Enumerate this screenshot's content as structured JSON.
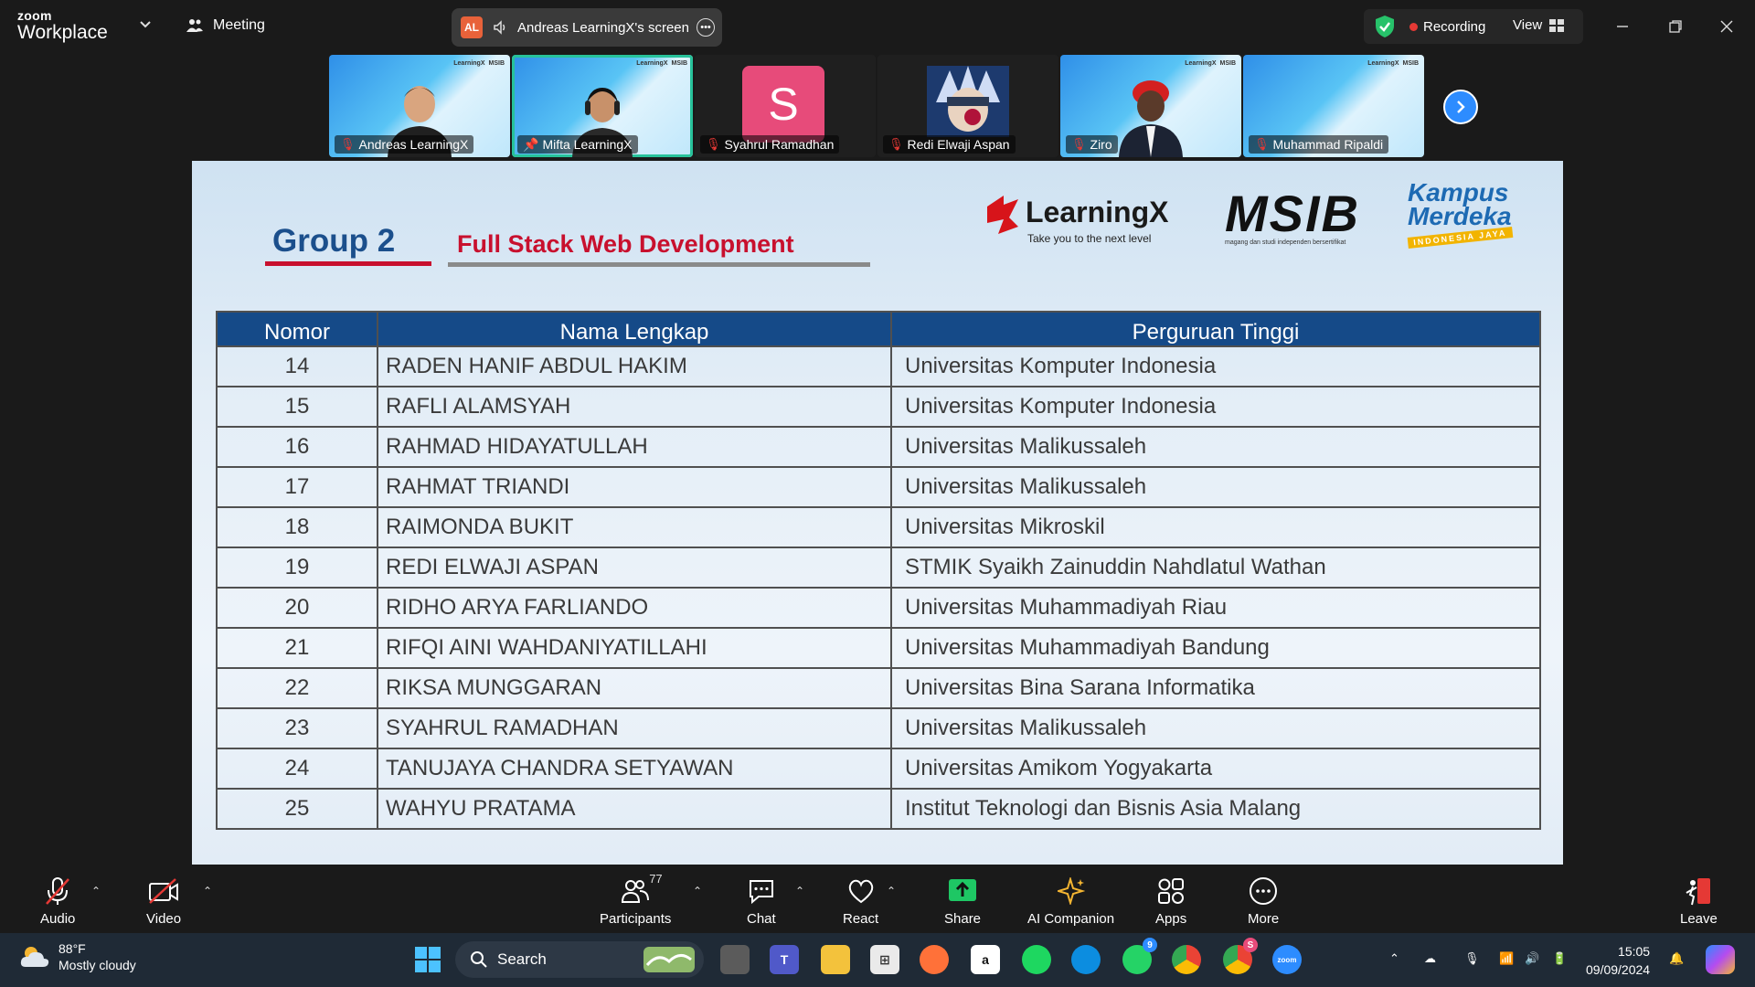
{
  "window": {
    "brand_small": "zoom",
    "brand_big": "Workplace",
    "meeting_label": "Meeting",
    "screen_share_badge": "AL",
    "screen_share_label": "Andreas LearningX's screen",
    "recording_label": "Recording",
    "view_label": "View"
  },
  "participants": [
    {
      "name": "Andreas LearningX",
      "type": "video"
    },
    {
      "name": "Mifta LearningX",
      "type": "video",
      "active": true
    },
    {
      "name": "Syahrul Ramadhan",
      "type": "avatar",
      "initial": "S",
      "color": "#e74b7a"
    },
    {
      "name": "Redi Elwaji Aspan",
      "type": "image"
    },
    {
      "name": "Ziro",
      "type": "avatar3d"
    },
    {
      "name": "Muhammad Ripaldi",
      "type": "video"
    }
  ],
  "slide": {
    "group_title": "Group 2",
    "track_title": "Full Stack Web Development",
    "logo_learningx": "LearningX",
    "logo_learningx_tagline": "Take you to the next level",
    "logo_msib": "MSIB",
    "logo_msib_tagline": "magang dan studi independen bersertifikat",
    "logo_kampus_1": "Kampus",
    "logo_kampus_2": "Merdeka",
    "logo_kampus_3": "INDONESIA JAYA",
    "table_headers": [
      "Nomor",
      "Nama Lengkap",
      "Perguruan Tinggi"
    ],
    "rows": [
      {
        "no": "14",
        "name": "RADEN HANIF ABDUL HAKIM",
        "univ": "Universitas Komputer Indonesia"
      },
      {
        "no": "15",
        "name": "RAFLI ALAMSYAH",
        "univ": "Universitas Komputer Indonesia"
      },
      {
        "no": "16",
        "name": "RAHMAD HIDAYATULLAH",
        "univ": "Universitas Malikussaleh"
      },
      {
        "no": "17",
        "name": "RAHMAT TRIANDI",
        "univ": "Universitas Malikussaleh"
      },
      {
        "no": "18",
        "name": "RAIMONDA BUKIT",
        "univ": "Universitas Mikroskil"
      },
      {
        "no": "19",
        "name": "REDI ELWAJI ASPAN",
        "univ": "STMIK Syaikh Zainuddin Nahdlatul Wathan"
      },
      {
        "no": "20",
        "name": "RIDHO ARYA FARLIANDO",
        "univ": "Universitas Muhammadiyah Riau"
      },
      {
        "no": "21",
        "name": "RIFQI AINI WAHDANIYATILLAHI",
        "univ": "Universitas Muhammadiyah Bandung"
      },
      {
        "no": "22",
        "name": "RIKSA MUNGGARAN",
        "univ": "Universitas Bina Sarana Informatika"
      },
      {
        "no": "23",
        "name": "SYAHRUL RAMADHAN",
        "univ": "Universitas Malikussaleh"
      },
      {
        "no": "24",
        "name": "TANUJAYA CHANDRA SETYAWAN",
        "univ": "Universitas Amikom Yogyakarta"
      },
      {
        "no": "25",
        "name": "WAHYU PRATAMA",
        "univ": "Institut Teknologi dan Bisnis Asia Malang"
      }
    ]
  },
  "toolbar": {
    "audio": "Audio",
    "video": "Video",
    "participants": "Participants",
    "participants_count": "77",
    "chat": "Chat",
    "react": "React",
    "share": "Share",
    "ai_companion": "AI Companion",
    "apps": "Apps",
    "more": "More",
    "leave": "Leave"
  },
  "taskbar": {
    "temperature": "88°F",
    "weather": "Mostly cloudy",
    "search_placeholder": "Search",
    "time": "15:05",
    "date": "09/09/2024",
    "whatsapp_badge": "9",
    "chrome_badge": "S"
  },
  "colors": {
    "accent_blue": "#2d8cff",
    "slide_header": "#154a88",
    "slide_red": "#c8102e",
    "active_speaker": "#27c29a",
    "recording_dot": "#e53935"
  }
}
